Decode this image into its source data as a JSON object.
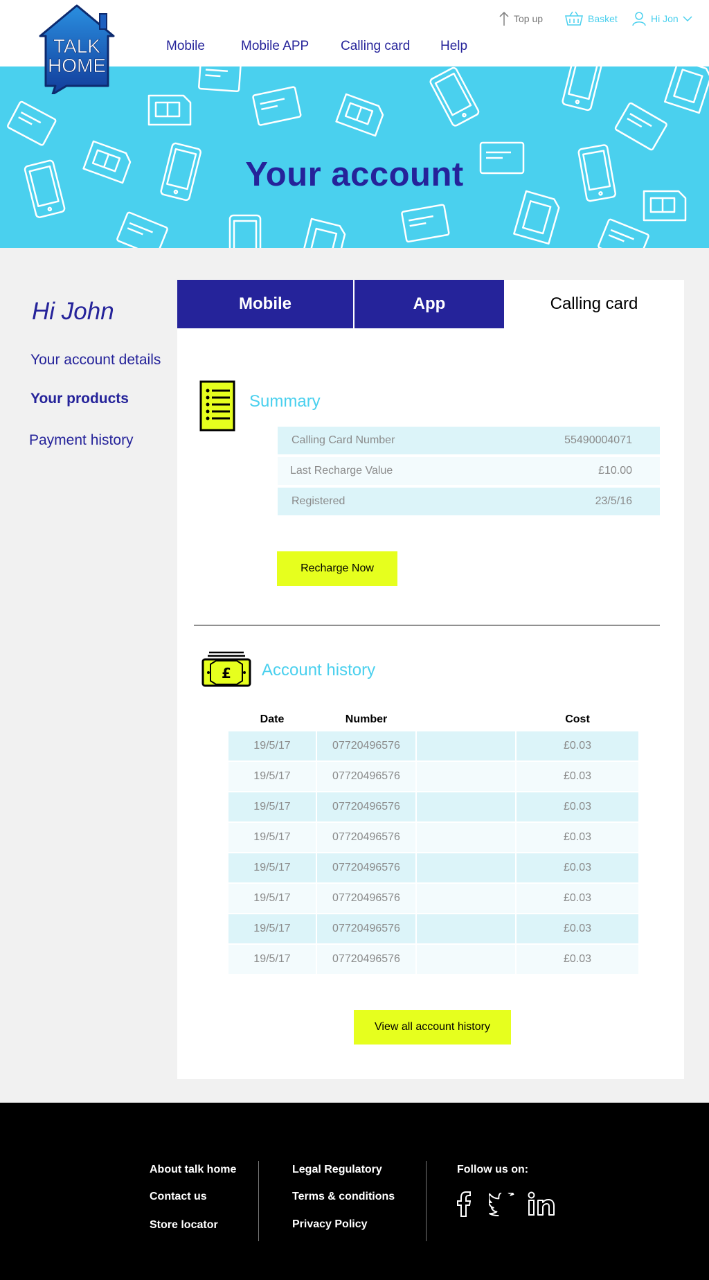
{
  "colors": {
    "brand_navy": "#25239a",
    "accent_cyan": "#4ad0ee",
    "cta_yellow": "#e6ff1e"
  },
  "header": {
    "logo_line1": "TALK",
    "logo_line2": "HOME",
    "nav": [
      "Mobile",
      "Mobile APP",
      "Calling card",
      "Help"
    ],
    "topup_label": "Top up",
    "basket_label": "Basket",
    "user_label": "Hi Jon",
    "icons": {
      "topup": "arrow-up-icon",
      "basket": "basket-icon",
      "user": "user-icon",
      "menu": "chevron-down-icon"
    }
  },
  "hero": {
    "title": "Your account"
  },
  "sidebar": {
    "greeting": "Hi John",
    "links": [
      "Your account details",
      "Your products",
      "Payment history"
    ],
    "active": "Your products"
  },
  "tabs": [
    "Mobile",
    "App",
    "Calling card"
  ],
  "summary": {
    "title": "Summary",
    "rows": [
      {
        "label": "Calling Card Number",
        "value": "55490004071"
      },
      {
        "label": "Last Recharge Value",
        "value": "£10.00"
      },
      {
        "label": "Registered",
        "value": "23/5/16"
      }
    ],
    "button": "Recharge Now"
  },
  "history": {
    "title": "Account history",
    "columns": {
      "date": "Date",
      "number": "Number",
      "cost": "Cost"
    },
    "rows": [
      {
        "date": "19/5/17",
        "number": "07720496576",
        "cost": "£0.03"
      },
      {
        "date": "19/5/17",
        "number": "07720496576",
        "cost": "£0.03"
      },
      {
        "date": "19/5/17",
        "number": "07720496576",
        "cost": "£0.03"
      },
      {
        "date": "19/5/17",
        "number": "07720496576",
        "cost": "£0.03"
      },
      {
        "date": "19/5/17",
        "number": "07720496576",
        "cost": "£0.03"
      },
      {
        "date": "19/5/17",
        "number": "07720496576",
        "cost": "£0.03"
      },
      {
        "date": "19/5/17",
        "number": "07720496576",
        "cost": "£0.03"
      },
      {
        "date": "19/5/17",
        "number": "07720496576",
        "cost": "£0.03"
      }
    ],
    "button": "View all account history"
  },
  "footer": {
    "col1": [
      "About talk home",
      "Contact us",
      "Store locator"
    ],
    "col2": [
      "Legal Regulatory",
      "Terms & conditions",
      "Privacy Policy"
    ],
    "follow_label": "Follow us on:",
    "social_icons": [
      "facebook-icon",
      "twitter-icon",
      "linkedin-icon"
    ]
  }
}
